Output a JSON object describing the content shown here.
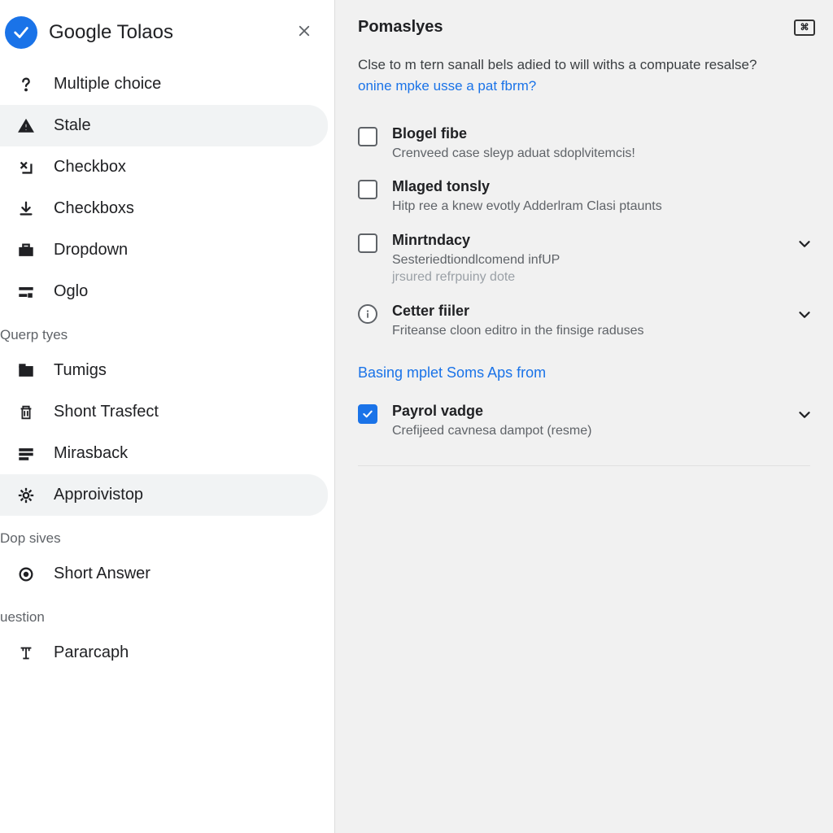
{
  "sidebar": {
    "title": "Google Tolaos",
    "items_a": [
      {
        "label": "Multiple choice"
      },
      {
        "label": "Stale"
      },
      {
        "label": "Checkbox"
      },
      {
        "label": "Checkboxs"
      },
      {
        "label": "Dropdown"
      },
      {
        "label": "Oglo"
      }
    ],
    "section_b_head": "Querp tyes",
    "items_b": [
      {
        "label": "Tumigs"
      },
      {
        "label": "Shont Trasfect"
      },
      {
        "label": "Mirasback"
      },
      {
        "label": "Approivistop"
      }
    ],
    "section_c_head": "Dop sives",
    "items_c": [
      {
        "label": "Short Answer"
      }
    ],
    "section_d_head": "uestion",
    "items_d": [
      {
        "label": "Pararcaph"
      }
    ]
  },
  "main": {
    "title": "Pomaslyes",
    "desc": "Clse to m tern sanall bels adied to will withs a compuate resalse?",
    "desc_link": "onine mpke usse a pat fbrm?",
    "options": [
      {
        "title": "Blogel fibe",
        "sub1": "Crenveed case sleyp aduat sdoplvitemcis!",
        "chev": false
      },
      {
        "title": "Mlaged tonsly",
        "sub1": "Hitp ree a knew evotly Adderlram Clasi ptaunts",
        "chev": false
      },
      {
        "title": "Minrtndacy",
        "sub1": "Sesteriedtiondlcomend infUP",
        "sub2": "jrsured refrpuiny dote",
        "chev": true
      },
      {
        "title": "Cetter fiiler",
        "sub1": "Friteanse cloon editro in the finsige raduses",
        "chev": true
      }
    ],
    "section_link": "Basing mplet Soms Aps from",
    "option_checked": {
      "title": "Payrol vadge",
      "sub1": "Crefijeed cavnesa dampot (resme)"
    }
  }
}
